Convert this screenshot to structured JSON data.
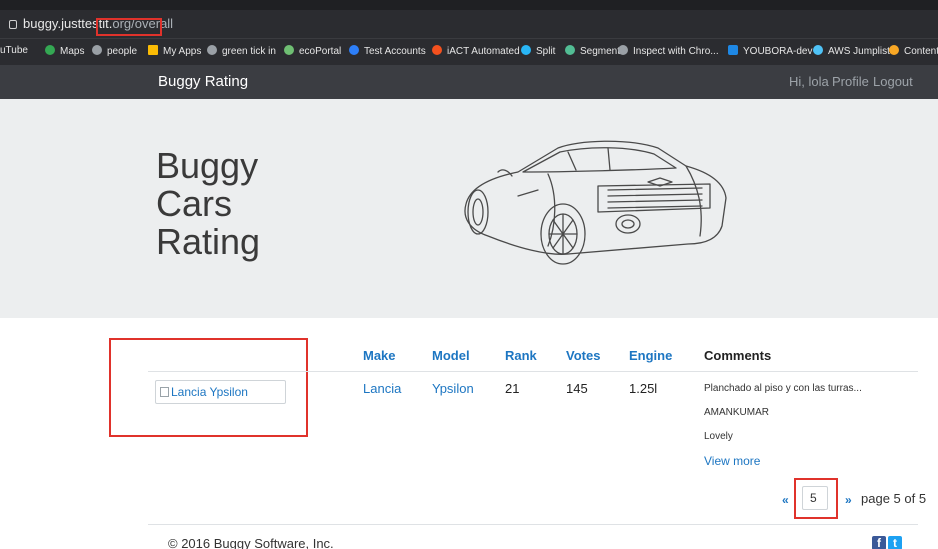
{
  "browser": {
    "url_host": "buggy.justtestit.",
    "url_path_highlighted": "org/overall",
    "bookmarks": [
      {
        "label": "uTube",
        "color": "#ff0000"
      },
      {
        "label": "Maps",
        "color": "#34a853"
      },
      {
        "label": "people",
        "color": "#9aa0a6"
      },
      {
        "label": "My Apps",
        "color": "#fbbc05"
      },
      {
        "label": "green tick in",
        "color": "#9aa0a6"
      },
      {
        "label": "ecoPortal",
        "color": "#6fbf73"
      },
      {
        "label": "Test Accounts",
        "color": "#2d7ff9"
      },
      {
        "label": "iACT Automated",
        "color": "#f4511e"
      },
      {
        "label": "Split",
        "color": "#29b6f6"
      },
      {
        "label": "Segment",
        "color": "#52bd94"
      },
      {
        "label": "Inspect with Chro...",
        "color": "#9aa0a6"
      },
      {
        "label": "YOUBORA-dev",
        "color": "#1e88e5"
      },
      {
        "label": "AWS Jumplist",
        "color": "#4fc3f7"
      },
      {
        "label": "Content",
        "color": "#f9a825"
      }
    ]
  },
  "navbar": {
    "brand": "Buggy Rating",
    "greeting": "Hi, lola",
    "profile": "Profile",
    "logout": "Logout"
  },
  "hero": {
    "line1": "Buggy",
    "line2": "Cars",
    "line3": "Rating"
  },
  "table": {
    "headers": {
      "make": "Make",
      "model": "Model",
      "rank": "Rank",
      "votes": "Votes",
      "engine": "Engine",
      "comments": "Comments"
    },
    "row": {
      "image_alt": "Lancia Ypsilon",
      "make": "Lancia",
      "model": "Ypsilon",
      "rank": "21",
      "votes": "145",
      "engine": "1.25l",
      "comments": [
        "Planchado al piso y con las turras...",
        "AMANKUMAR",
        "Lovely"
      ],
      "view_more": "View more"
    }
  },
  "pagination": {
    "prev": "«",
    "current": "5",
    "next": "»",
    "label": "page 5 of 5"
  },
  "footer": {
    "copyright": "© 2016 Buggy Software, Inc.",
    "facebook_glyph": "f",
    "twitter_glyph": "t",
    "facebook_color": "#3b5998",
    "twitter_color": "#1da1f2"
  },
  "colors": {
    "link": "#1d76c2",
    "annotation_red": "#e0322b",
    "navbar_bg": "#3b3d42",
    "hero_bg": "#eceeef"
  }
}
